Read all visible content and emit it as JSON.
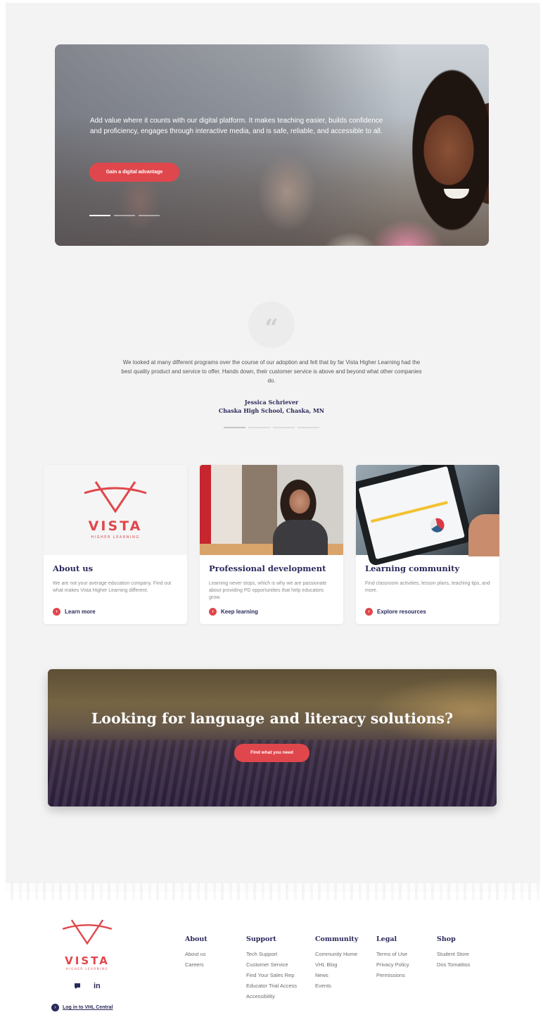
{
  "hero": {
    "text": "Add value where it counts with our digital platform. It makes teaching easier, builds confidence and proficiency, engages through interactive media, and is safe, reliable, and accessible to all.",
    "button_label": "Gain a digital advantage",
    "slide_count": 3,
    "active_slide": 1
  },
  "testimonial": {
    "quote_mark": "66",
    "quote": "We looked at many different programs over the course of our adoption and felt that by far Vista Higher Learning had the best quality product and service to offer. Hands down, their customer service is above and beyond what other companies do.",
    "author": "Jessica Schriever",
    "school": "Chaska High School, Chaska, MN",
    "slide_count": 4,
    "active_slide": 1
  },
  "brand": {
    "name": "VISTA",
    "tagline": "HIGHER LEARNING",
    "accent_color": "#e0474c",
    "navy_color": "#2b2a5c"
  },
  "cards": [
    {
      "title": "About us",
      "description": "We are not your average education company. Find out what makes Vista Higher Learning different.",
      "link": "Learn more",
      "image_icon": "vista-logo"
    },
    {
      "title": "Professional development",
      "description": "Learning never stops, which is why we are passionate about providing PD opportunities that help educators grow.",
      "link": "Keep learning",
      "image_icon": "teacher-photo"
    },
    {
      "title": "Learning community",
      "description": "Find classroom activities, lesson plans, teaching tips, and more.",
      "link": "Explore resources",
      "image_icon": "tablet-photo"
    }
  ],
  "banner": {
    "title": "Looking for language and literacy solutions?",
    "button_label": "Find what you need"
  },
  "footer": {
    "social": [
      "comment-icon",
      "linkedin-icon"
    ],
    "social_labels": [
      "",
      "in"
    ],
    "login_label": "Log in to VHL Central",
    "columns": [
      {
        "heading": "About",
        "links": [
          "About us",
          "Careers"
        ]
      },
      {
        "heading": "Support",
        "links": [
          "Tech Support",
          "Customer Service",
          "Find Your Sales Rep",
          "Educator Trial Access",
          "Accessibility"
        ]
      },
      {
        "heading": "Community",
        "links": [
          "Community Home",
          "VHL Blog",
          "News",
          "Events"
        ]
      },
      {
        "heading": "Legal",
        "links": [
          "Terms of Use",
          "Privacy Policy",
          "Permissions"
        ]
      },
      {
        "heading": "Shop",
        "links": [
          "Student Store",
          "Dos Tomatitos"
        ]
      }
    ]
  }
}
